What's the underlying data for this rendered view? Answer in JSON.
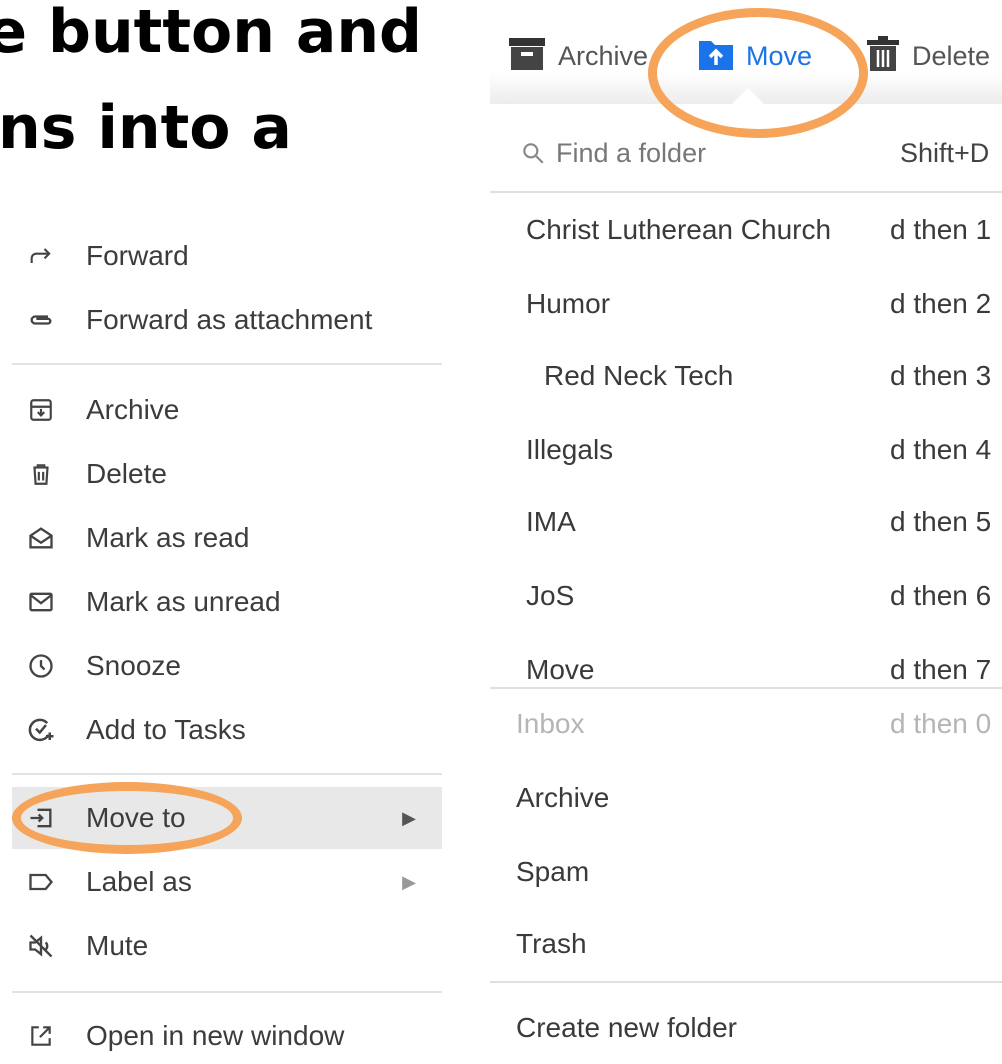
{
  "heading": {
    "line1": "e button and",
    "line2": "ns into a"
  },
  "context_menu": {
    "items": [
      {
        "label": "Forward",
        "icon": "forward-icon"
      },
      {
        "label": "Forward as attachment",
        "icon": "attachment-icon"
      },
      {
        "label": "Archive",
        "icon": "archive-icon"
      },
      {
        "label": "Delete",
        "icon": "trash-icon"
      },
      {
        "label": "Mark as read",
        "icon": "envelope-open-icon"
      },
      {
        "label": "Mark as unread",
        "icon": "envelope-icon"
      },
      {
        "label": "Snooze",
        "icon": "clock-icon"
      },
      {
        "label": "Add to Tasks",
        "icon": "add-task-icon"
      },
      {
        "label": "Move to",
        "icon": "move-to-icon"
      },
      {
        "label": "Label as",
        "icon": "label-icon"
      },
      {
        "label": "Mute",
        "icon": "mute-icon"
      },
      {
        "label": "Open in new window",
        "icon": "open-new-window-icon"
      }
    ]
  },
  "toolbar": {
    "archive": "Archive",
    "move": "Move",
    "delete": "Delete"
  },
  "folder_search": {
    "placeholder": "Find a folder",
    "shortcut": "Shift+D"
  },
  "folders": [
    {
      "name": "Christ Lutherean Church",
      "shortcut": "d then 1"
    },
    {
      "name": "Humor",
      "shortcut": "d then 2"
    },
    {
      "name": "Red Neck Tech",
      "shortcut": "d then 3"
    },
    {
      "name": "Illegals",
      "shortcut": "d then 4"
    },
    {
      "name": "IMA",
      "shortcut": "d then 5"
    },
    {
      "name": "JoS",
      "shortcut": "d then 6"
    },
    {
      "name": "Move",
      "shortcut": "d then 7"
    }
  ],
  "system_folders": {
    "inbox": "Inbox",
    "inbox_shortcut": "d then 0",
    "archive": "Archive",
    "spam": "Spam",
    "trash": "Trash"
  },
  "create_new_folder": "Create new folder",
  "colors": {
    "accent": "#1a73e8",
    "highlight_ring": "#f6a45a"
  }
}
